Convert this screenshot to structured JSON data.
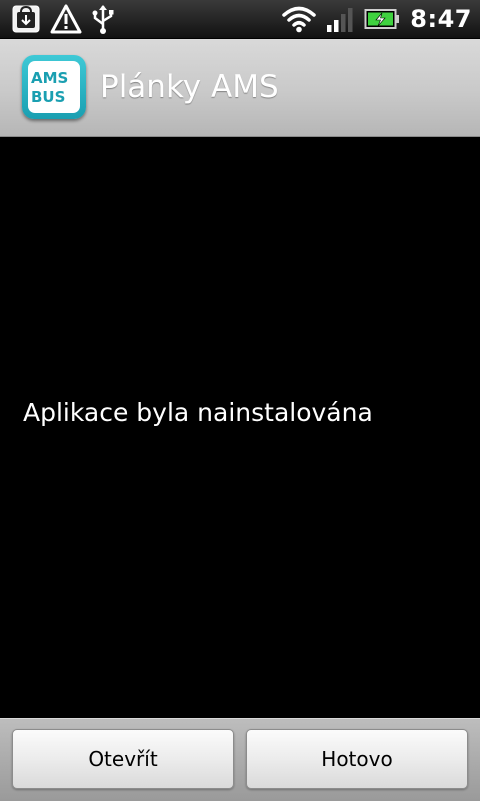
{
  "status_bar": {
    "left_icons": [
      "market-download-icon",
      "warning-icon",
      "usb-icon"
    ],
    "right_icons": [
      "wifi-icon",
      "signal-icon",
      "battery-charging-icon"
    ],
    "time": "8:47"
  },
  "header": {
    "app_icon": "ams-bus-app-icon",
    "app_icon_text_top": "AMS",
    "app_icon_text_bottom": "BUS",
    "title": "Plánky AMS"
  },
  "content": {
    "message": "Aplikace byla nainstalována"
  },
  "actions": {
    "open_label": "Otevřít",
    "done_label": "Hotovo"
  },
  "colors": {
    "icon_accent": "#1a9fb1",
    "battery_green": "#3fd23f"
  }
}
